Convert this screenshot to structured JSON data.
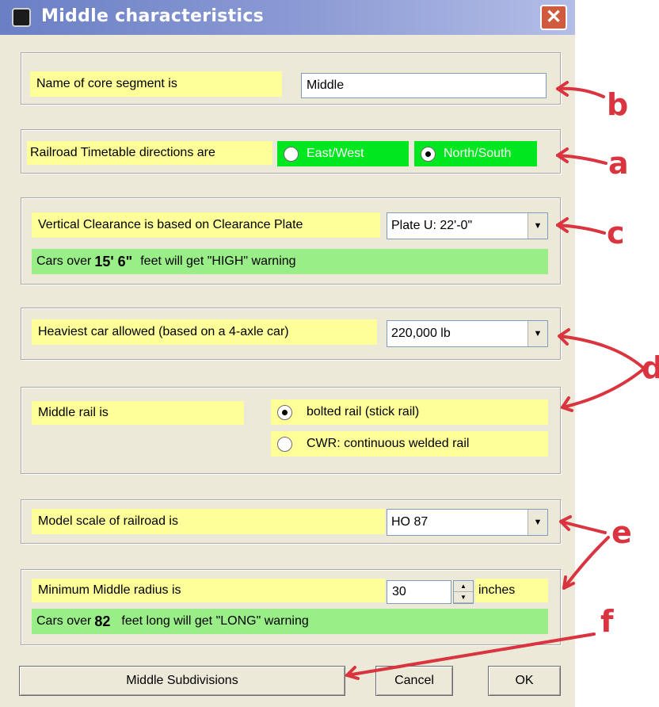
{
  "window": {
    "title": "Middle characteristics",
    "close_symbol": "✕"
  },
  "segment": {
    "label": "Name of core segment is",
    "value": "Middle"
  },
  "directions": {
    "label": "Railroad Timetable directions are",
    "option_1": "East/West",
    "option_2": "North/South",
    "selected": "North/South"
  },
  "clearance": {
    "label": "Vertical Clearance is based on Clearance Plate",
    "plate": "Plate U: 22'-0\"",
    "warn_prefix": "Cars over",
    "warn_value": "15' 6\"",
    "warn_suffix": "feet will get \"HIGH\" warning"
  },
  "weight": {
    "label": "Heaviest car allowed  (based on a 4-axle car)",
    "value": "220,000 lb"
  },
  "rail": {
    "label": "Middle rail is",
    "option_1": "bolted rail (stick rail)",
    "option_2": "CWR: continuous welded rail",
    "selected": "bolted rail (stick rail)"
  },
  "scale": {
    "label": "Model scale of railroad is",
    "value": "HO 87"
  },
  "radius": {
    "label": "Minimum Middle radius is",
    "value": "30",
    "unit": "inches",
    "warn_prefix": "Cars over",
    "warn_value": "82",
    "warn_suffix": "feet long will get \"LONG\" warning"
  },
  "buttons": {
    "subdivisions": "Middle Subdivisions",
    "cancel": "Cancel",
    "ok": "OK"
  },
  "annotations": {
    "a": "a",
    "b": "b",
    "c": "c",
    "d": "d",
    "e": "e",
    "f": "f"
  },
  "colors": {
    "yellow_label": "#ffff99",
    "green_radio": "#00e61f",
    "green_warning": "#99ee88",
    "annotation_red": "#d9343f"
  }
}
